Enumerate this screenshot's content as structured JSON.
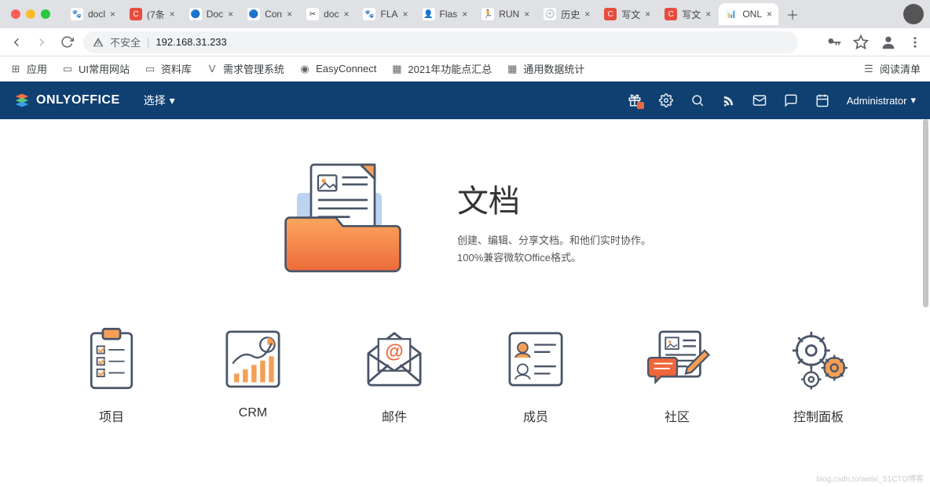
{
  "browser": {
    "tabs": [
      {
        "label": "docl",
        "fav_bg": "#fff",
        "fav_txt": "🐾"
      },
      {
        "label": "(7条",
        "fav_bg": "#e74c3c",
        "fav_txt": "C"
      },
      {
        "label": "Doc",
        "fav_bg": "#fff",
        "fav_txt": "🔵"
      },
      {
        "label": "Con",
        "fav_bg": "#fff",
        "fav_txt": "🔵"
      },
      {
        "label": "doc",
        "fav_bg": "#fff",
        "fav_txt": "✂"
      },
      {
        "label": "FLA",
        "fav_bg": "#fff",
        "fav_txt": "🐾"
      },
      {
        "label": "Flas",
        "fav_bg": "#fff",
        "fav_txt": "👤"
      },
      {
        "label": "RUN",
        "fav_bg": "#fff",
        "fav_txt": "🏃"
      },
      {
        "label": "历史",
        "fav_bg": "#fff",
        "fav_txt": "🕘"
      },
      {
        "label": "写文",
        "fav_bg": "#e74c3c",
        "fav_txt": "C"
      },
      {
        "label": "写文",
        "fav_bg": "#e74c3c",
        "fav_txt": "C"
      },
      {
        "label": "ONL",
        "fav_bg": "#fff",
        "fav_txt": "📊",
        "active": true
      }
    ],
    "security_label": "不安全",
    "url": "192.168.31.233",
    "bookmarks": [
      {
        "label": "应用",
        "icon": "⊞"
      },
      {
        "label": "UI常用网站",
        "icon": "▭"
      },
      {
        "label": "资料库",
        "icon": "▭"
      },
      {
        "label": "需求管理系统",
        "icon": "V"
      },
      {
        "label": "EasyConnect",
        "icon": "◉"
      },
      {
        "label": "2021年功能点汇总",
        "icon": "▦"
      },
      {
        "label": "通用数据统计",
        "icon": "▦"
      }
    ],
    "reading_list": "阅读清单"
  },
  "app": {
    "brand": "ONLYOFFICE",
    "select_label": "选择",
    "admin_label": "Administrator"
  },
  "hero": {
    "title": "文档",
    "desc": "创建、编辑、分享文档。和他们实时协作。100%兼容微软Office格式。"
  },
  "modules": [
    {
      "label": "项目"
    },
    {
      "label": "CRM"
    },
    {
      "label": "邮件"
    },
    {
      "label": "成员"
    },
    {
      "label": "社区"
    },
    {
      "label": "控制面板"
    }
  ],
  "watermark": "blog.csdn.to/weixi_51CTO博客"
}
